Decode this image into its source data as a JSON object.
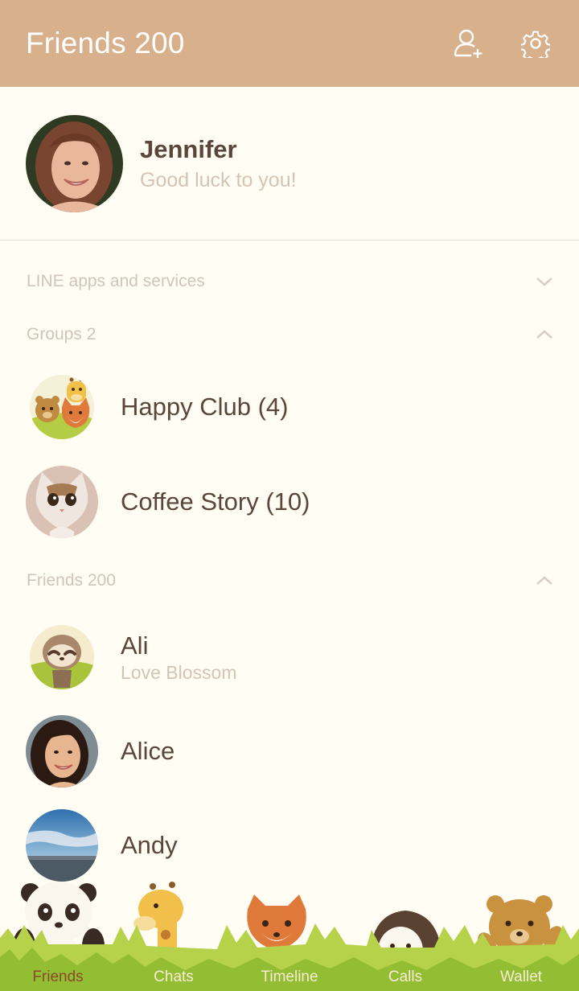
{
  "header": {
    "title": "Friends 200",
    "icons": [
      "add-friend-icon",
      "settings-icon"
    ]
  },
  "profile": {
    "name": "Jennifer",
    "status": "Good luck to you!"
  },
  "sections": {
    "line_apps": "LINE apps and services",
    "groups": "Groups 2",
    "friends": "Friends 200"
  },
  "groups": [
    {
      "name": "Happy Club (4)"
    },
    {
      "name": "Coffee Story (10)"
    }
  ],
  "friends": [
    {
      "name": "Ali",
      "status": "Love Blossom"
    },
    {
      "name": "Alice",
      "status": ""
    },
    {
      "name": "Andy",
      "status": ""
    }
  ],
  "tabs": [
    "Friends",
    "Chats",
    "Timeline",
    "Calls",
    "Wallet"
  ],
  "active_tab": "Friends",
  "colors": {
    "header_bg": "#d8b08c",
    "page_bg": "#fffdf4",
    "primary_text": "#5a463b",
    "secondary_text": "#d4c4b6",
    "active_tab": "#8a4a26",
    "grass": "#9cc63e"
  }
}
